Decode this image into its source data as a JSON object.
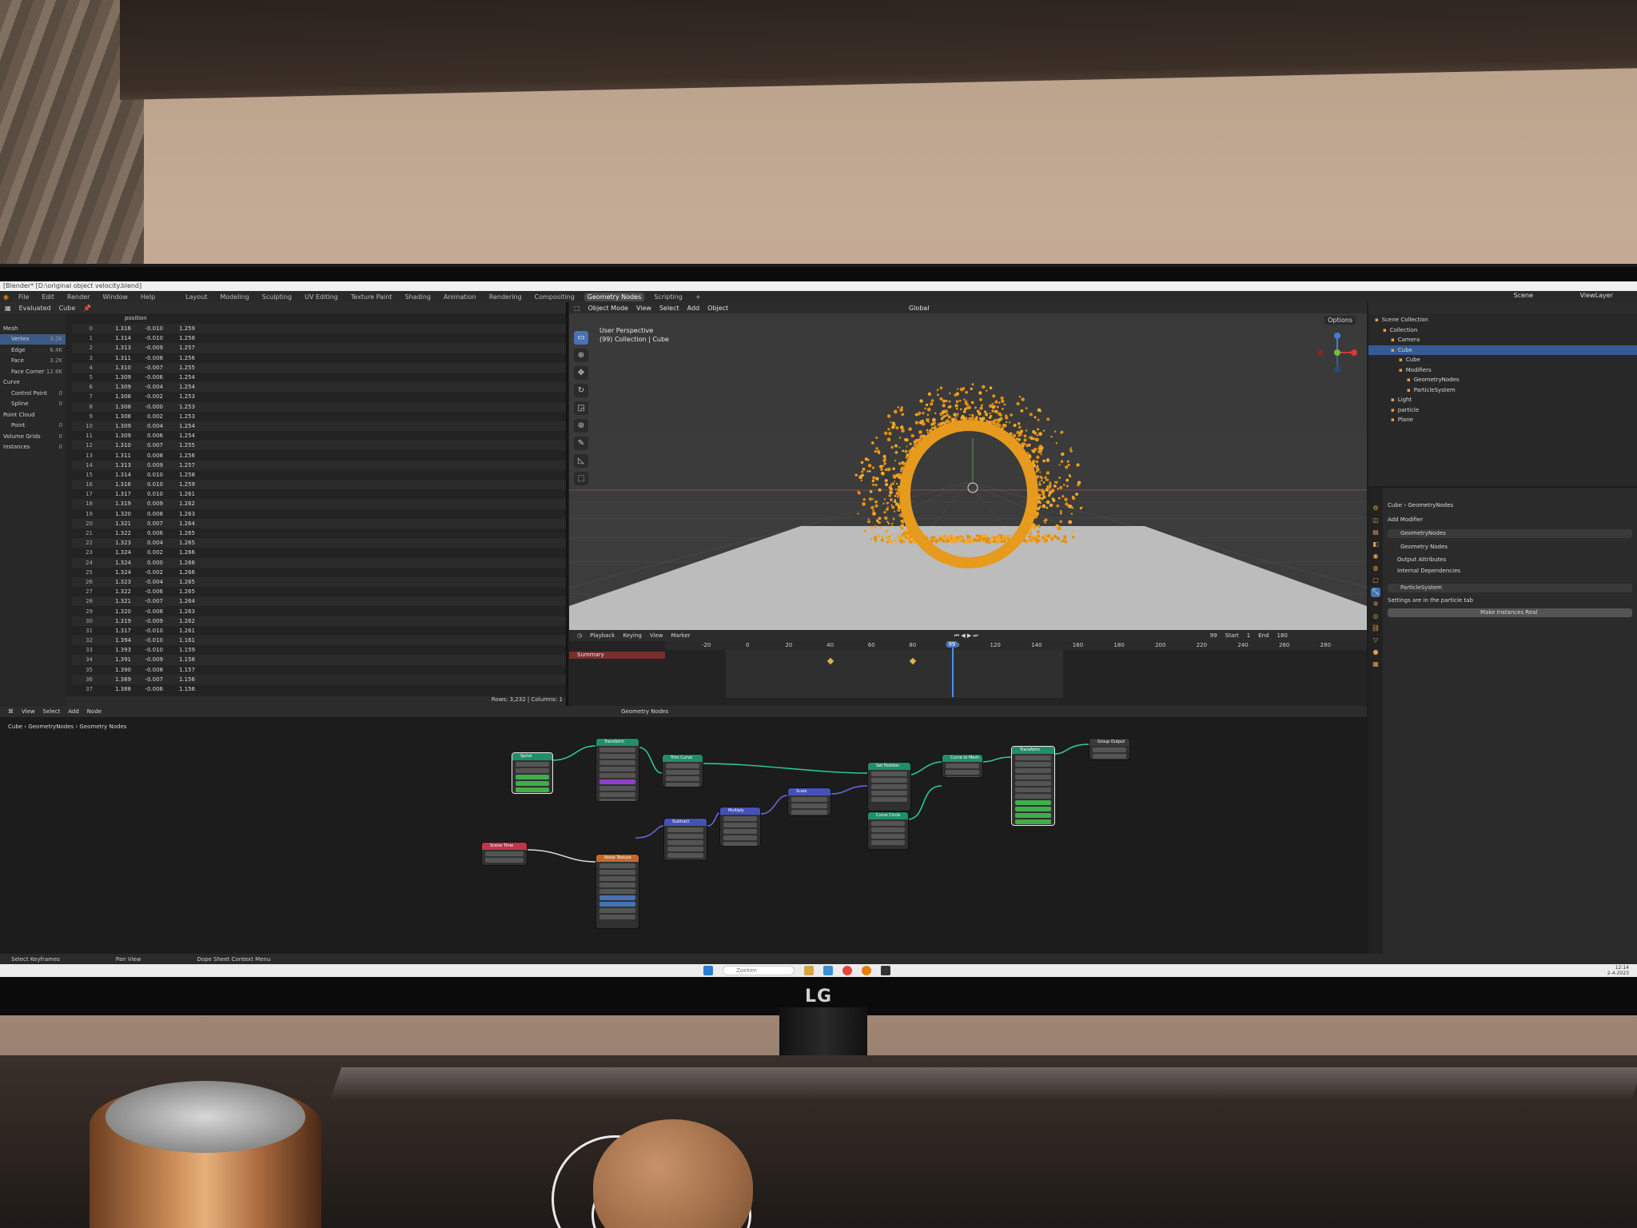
{
  "title_bar": "[Blender* [D:\\original object velocity.blend]",
  "menu": [
    "File",
    "Edit",
    "Render",
    "Window",
    "Help"
  ],
  "workspaces": [
    "Layout",
    "Modeling",
    "Sculpting",
    "UV Editing",
    "Texture Paint",
    "Shading",
    "Animation",
    "Rendering",
    "Compositing",
    "Geometry Nodes",
    "Scripting"
  ],
  "active_workspace": "Geometry Nodes",
  "scene": "Scene",
  "view_layer": "ViewLayer",
  "spreadsheet": {
    "mode": "Evaluated",
    "object": "Cube",
    "column": "position",
    "sidebar": [
      {
        "label": "Mesh",
        "count": ""
      },
      {
        "label": "Vertex",
        "count": "3.2K"
      },
      {
        "label": "Edge",
        "count": "6.4K"
      },
      {
        "label": "Face",
        "count": "3.2K"
      },
      {
        "label": "Face Corner",
        "count": "12.8K"
      },
      {
        "label": "Curve",
        "count": ""
      },
      {
        "label": "Control Point",
        "count": "0"
      },
      {
        "label": "Spline",
        "count": "0"
      },
      {
        "label": "Point Cloud",
        "count": ""
      },
      {
        "label": "Point",
        "count": "0"
      },
      {
        "label": "Volume Grids",
        "count": "0"
      },
      {
        "label": "Instances",
        "count": "0"
      }
    ],
    "rows": [
      [
        "0",
        "1.316",
        "-0.010",
        "1.259"
      ],
      [
        "1",
        "1.314",
        "-0.010",
        "1.258"
      ],
      [
        "2",
        "1.313",
        "-0.009",
        "1.257"
      ],
      [
        "3",
        "1.311",
        "-0.008",
        "1.256"
      ],
      [
        "4",
        "1.310",
        "-0.007",
        "1.255"
      ],
      [
        "5",
        "1.309",
        "-0.006",
        "1.254"
      ],
      [
        "6",
        "1.309",
        "-0.004",
        "1.254"
      ],
      [
        "7",
        "1.308",
        "-0.002",
        "1.253"
      ],
      [
        "8",
        "1.308",
        "-0.000",
        "1.253"
      ],
      [
        "9",
        "1.308",
        "0.002",
        "1.253"
      ],
      [
        "10",
        "1.309",
        "0.004",
        "1.254"
      ],
      [
        "11",
        "1.309",
        "0.006",
        "1.254"
      ],
      [
        "12",
        "1.310",
        "0.007",
        "1.255"
      ],
      [
        "13",
        "1.311",
        "0.008",
        "1.256"
      ],
      [
        "14",
        "1.313",
        "0.009",
        "1.257"
      ],
      [
        "15",
        "1.314",
        "0.010",
        "1.258"
      ],
      [
        "16",
        "1.316",
        "0.010",
        "1.259"
      ],
      [
        "17",
        "1.317",
        "0.010",
        "1.261"
      ],
      [
        "18",
        "1.319",
        "0.009",
        "1.262"
      ],
      [
        "19",
        "1.320",
        "0.008",
        "1.263"
      ],
      [
        "20",
        "1.321",
        "0.007",
        "1.264"
      ],
      [
        "21",
        "1.322",
        "0.006",
        "1.265"
      ],
      [
        "22",
        "1.323",
        "0.004",
        "1.265"
      ],
      [
        "23",
        "1.324",
        "0.002",
        "1.266"
      ],
      [
        "24",
        "1.324",
        "0.000",
        "1.266"
      ],
      [
        "25",
        "1.324",
        "-0.002",
        "1.266"
      ],
      [
        "26",
        "1.323",
        "-0.004",
        "1.265"
      ],
      [
        "27",
        "1.322",
        "-0.006",
        "1.265"
      ],
      [
        "28",
        "1.321",
        "-0.007",
        "1.264"
      ],
      [
        "29",
        "1.320",
        "-0.008",
        "1.263"
      ],
      [
        "30",
        "1.319",
        "-0.009",
        "1.262"
      ],
      [
        "31",
        "1.317",
        "-0.010",
        "1.261"
      ],
      [
        "32",
        "1.394",
        "-0.010",
        "1.161"
      ],
      [
        "33",
        "1.393",
        "-0.010",
        "1.159"
      ],
      [
        "34",
        "1.391",
        "-0.009",
        "1.158"
      ],
      [
        "35",
        "1.390",
        "-0.008",
        "1.157"
      ],
      [
        "36",
        "1.389",
        "-0.007",
        "1.156"
      ],
      [
        "37",
        "1.388",
        "-0.006",
        "1.156"
      ]
    ],
    "footer": "Rows: 3,232  |  Columns: 1"
  },
  "viewport": {
    "mode": "Object Mode",
    "menus": [
      "View",
      "Select",
      "Add",
      "Object"
    ],
    "transform": "Global",
    "info_line1": "User Perspective",
    "info_line2": "(99) Collection | Cube",
    "options": "Options"
  },
  "timeline": {
    "menus": [
      "Playback",
      "Keying",
      "View",
      "Marker"
    ],
    "summary": "Summary",
    "current_frame": "99",
    "start_label": "Start",
    "start": "1",
    "end_label": "End",
    "end": "180",
    "ticks": [
      "-20",
      "0",
      "20",
      "40",
      "60",
      "80",
      "100",
      "120",
      "140",
      "160",
      "180",
      "200",
      "220",
      "240",
      "260",
      "280"
    ],
    "keyframes": [
      40,
      80
    ]
  },
  "outliner": {
    "items": [
      {
        "label": "Scene Collection",
        "depth": 0,
        "icon": "collection-icon",
        "sel": false
      },
      {
        "label": "Collection",
        "depth": 1,
        "icon": "collection-icon",
        "sel": false
      },
      {
        "label": "Camera",
        "depth": 2,
        "icon": "camera-icon",
        "sel": false
      },
      {
        "label": "Cube",
        "depth": 2,
        "icon": "mesh-icon",
        "sel": true
      },
      {
        "label": "Cube",
        "depth": 3,
        "icon": "mesh-data-icon",
        "sel": false
      },
      {
        "label": "Modifiers",
        "depth": 3,
        "icon": "wrench-icon",
        "sel": false
      },
      {
        "label": "GeometryNodes",
        "depth": 4,
        "icon": "nodes-icon",
        "sel": false
      },
      {
        "label": "ParticleSystem",
        "depth": 4,
        "icon": "particles-icon",
        "sel": false
      },
      {
        "label": "Light",
        "depth": 2,
        "icon": "light-icon",
        "sel": false
      },
      {
        "label": "particle",
        "depth": 2,
        "icon": "mesh-icon",
        "sel": false
      },
      {
        "label": "Plane",
        "depth": 2,
        "icon": "mesh-icon",
        "sel": false
      }
    ]
  },
  "properties": {
    "breadcrumb_object": "Cube",
    "breadcrumb_modifier": "GeometryNodes",
    "add_modifier": "Add Modifier",
    "modifier_name": "GeometryNodes",
    "node_group": "Geometry Nodes",
    "output_attributes": "Output Attributes",
    "internal_dependencies": "Internal Dependencies",
    "particle_modifier": "ParticleSystem",
    "particle_note": "Settings are in the particle tab",
    "make_real": "Make Instances Real"
  },
  "node_editor": {
    "menus": [
      "View",
      "Select",
      "Add",
      "Node"
    ],
    "tree_name": "Geometry Nodes",
    "breadcrumb": [
      "Cube",
      "GeometryNodes",
      "Geometry Nodes"
    ],
    "nodes": [
      {
        "title": "Spiral",
        "color": "#1f8f6a"
      },
      {
        "title": "Transform",
        "color": "#1f8f6a"
      },
      {
        "title": "Trim Curve",
        "color": "#1f8f6a"
      },
      {
        "title": "Set Position",
        "color": "#1f8f6a"
      },
      {
        "title": "Curve to Mesh",
        "color": "#1f8f6a"
      },
      {
        "title": "Transform",
        "color": "#1f8f6a"
      },
      {
        "title": "Group Output",
        "color": "#3a3a3a"
      },
      {
        "title": "Scale",
        "color": "#4651b8"
      },
      {
        "title": "Multiply",
        "color": "#4651b8"
      },
      {
        "title": "Subtract",
        "color": "#4651b8"
      },
      {
        "title": "Curve Circle",
        "color": "#1f8f6a"
      },
      {
        "title": "Noise Texture",
        "color": "#c26a2c"
      },
      {
        "title": "Scene Time",
        "color": "#c2344a"
      }
    ]
  },
  "status_bar": [
    "Select Keyframes",
    "Pan View",
    "Dope Sheet Context Menu"
  ],
  "taskbar": {
    "search": "Zoeken",
    "time": "12:14",
    "date": "2-4-2023"
  },
  "monitor_brand": "LG"
}
